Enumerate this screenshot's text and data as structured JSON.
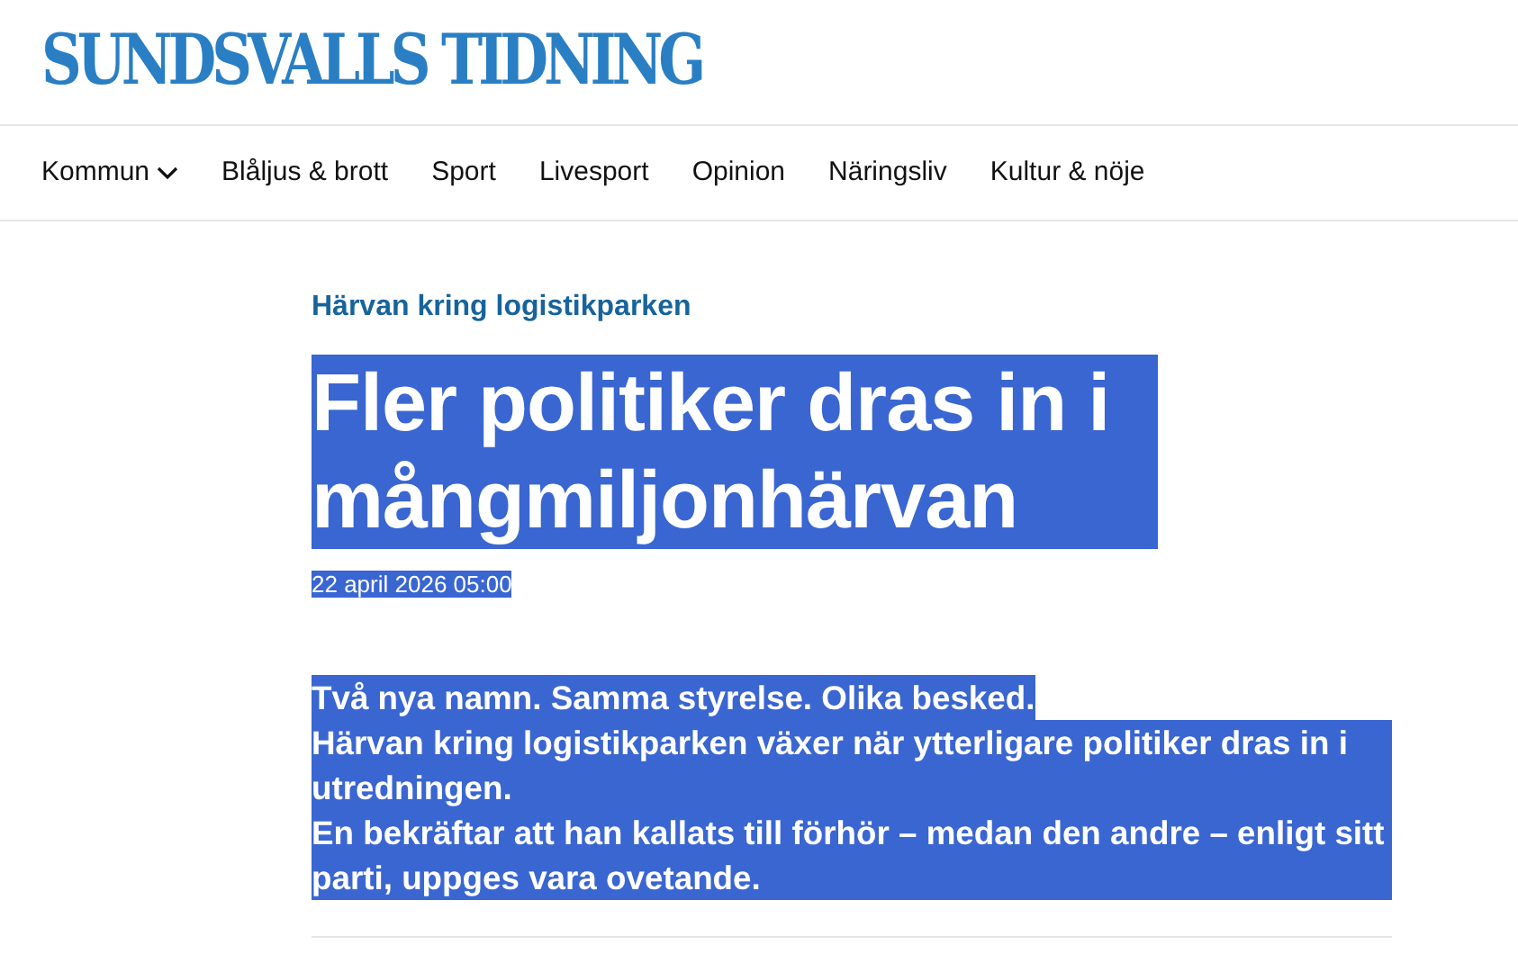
{
  "logo": "SUNDSVALLS TIDNING",
  "nav": [
    {
      "label": "Kommun",
      "has_dropdown": true
    },
    {
      "label": "Blåljus & brott",
      "has_dropdown": false
    },
    {
      "label": "Sport",
      "has_dropdown": false
    },
    {
      "label": "Livesport",
      "has_dropdown": false
    },
    {
      "label": "Opinion",
      "has_dropdown": false
    },
    {
      "label": "Näringsliv",
      "has_dropdown": false
    },
    {
      "label": "Kultur & nöje",
      "has_dropdown": false
    }
  ],
  "article": {
    "topic": "Härvan kring logistikparken",
    "text_selected": true,
    "headline": "Fler politiker dras in i mångmiljonhärvan",
    "date": "22 april 2026 05:00",
    "lead": [
      "Två nya namn. Samma styrelse. Olika besked.",
      "Härvan kring logistikparken växer när ytterligare politiker dras in i utredningen.",
      "En bekräftar att han kallats till förhör – medan den andre – enligt sitt parti, uppges vara ovetande."
    ]
  }
}
